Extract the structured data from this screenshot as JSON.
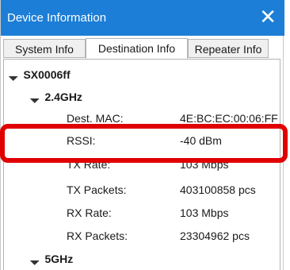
{
  "window": {
    "title": "Device Information",
    "close_glyph": "✕"
  },
  "tabs": [
    {
      "label": "System Info",
      "active": false
    },
    {
      "label": "Destination Info",
      "active": true
    },
    {
      "label": "Repeater Info",
      "active": false
    }
  ],
  "tree": {
    "root": "SX0006ff",
    "band1": "2.4GHz",
    "rows": [
      {
        "label": "Dest. MAC:",
        "value": "4E:BC:EC:00:06:FF"
      },
      {
        "label": "RSSI:",
        "value": "-40 dBm"
      },
      {
        "label": "TX Rate:",
        "value": "103 Mbps"
      },
      {
        "label": "TX Packets:",
        "value": "403100858 pcs"
      },
      {
        "label": "RX Rate:",
        "value": "103 Mbps"
      },
      {
        "label": "RX Packets:",
        "value": "23304962 pcs"
      }
    ],
    "band2": "5GHz"
  },
  "colors": {
    "titlebar": "#1c7ed6",
    "highlight": "#e00000"
  }
}
